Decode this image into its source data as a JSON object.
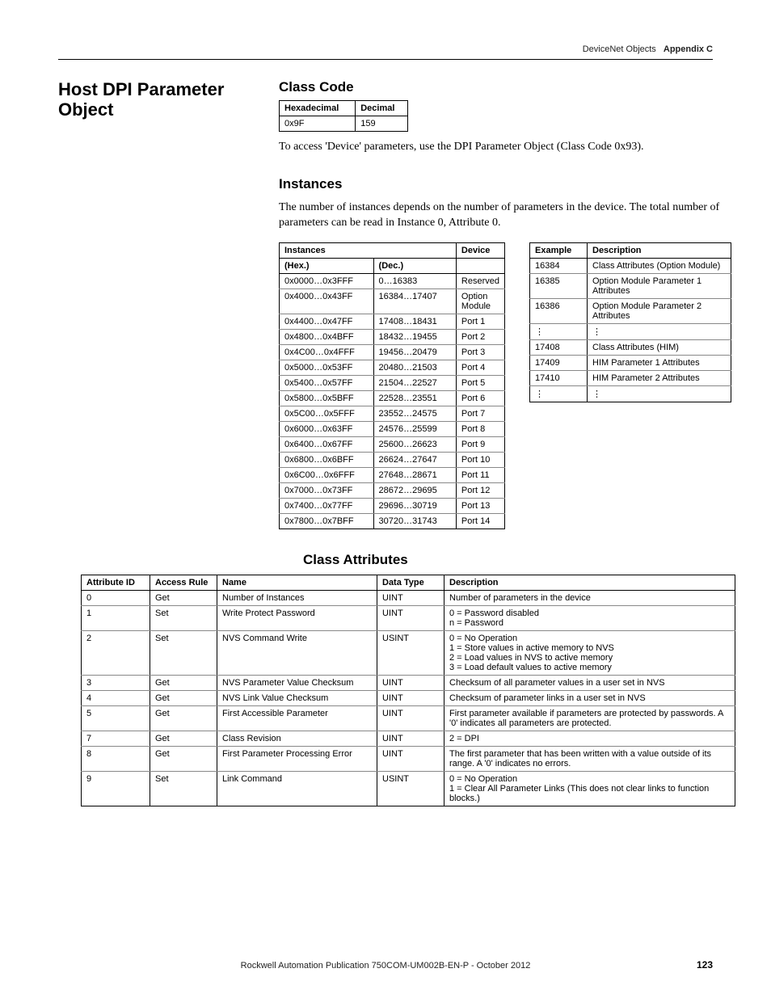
{
  "header": {
    "chapter_title": "DeviceNet Objects",
    "appendix": "Appendix C"
  },
  "section": {
    "title": "Host DPI Parameter Object"
  },
  "class_code": {
    "heading": "Class Code",
    "col_hex": "Hexadecimal",
    "col_dec": "Decimal",
    "row_hex": "0x9F",
    "row_dec": "159",
    "paragraph": "To access 'Device' parameters, use the DPI Parameter Object (Class Code 0x93)."
  },
  "instances": {
    "heading": "Instances",
    "paragraph": "The number of instances depends on the number of parameters in the device. The total number of parameters can be read in Instance 0, Attribute 0.",
    "t1": {
      "h_inst": "Instances",
      "h_dev": "Device",
      "h_hex": "(Hex.)",
      "h_dec": "(Dec.)",
      "rows": [
        {
          "hex": "0x0000…0x3FFF",
          "dec": "0…16383",
          "dev": "Reserved"
        },
        {
          "hex": "0x4000…0x43FF",
          "dec": "16384…17407",
          "dev": "Option Module"
        },
        {
          "hex": "0x4400…0x47FF",
          "dec": "17408…18431",
          "dev": "Port 1"
        },
        {
          "hex": "0x4800…0x4BFF",
          "dec": "18432…19455",
          "dev": "Port 2"
        },
        {
          "hex": "0x4C00…0x4FFF",
          "dec": "19456…20479",
          "dev": "Port 3"
        },
        {
          "hex": "0x5000…0x53FF",
          "dec": "20480…21503",
          "dev": "Port 4"
        },
        {
          "hex": "0x5400…0x57FF",
          "dec": "21504…22527",
          "dev": "Port 5"
        },
        {
          "hex": "0x5800…0x5BFF",
          "dec": "22528…23551",
          "dev": "Port 6"
        },
        {
          "hex": "0x5C00…0x5FFF",
          "dec": "23552…24575",
          "dev": "Port 7"
        },
        {
          "hex": "0x6000…0x63FF",
          "dec": "24576…25599",
          "dev": "Port 8"
        },
        {
          "hex": "0x6400…0x67FF",
          "dec": "25600…26623",
          "dev": "Port 9"
        },
        {
          "hex": "0x6800…0x6BFF",
          "dec": "26624…27647",
          "dev": "Port 10"
        },
        {
          "hex": "0x6C00…0x6FFF",
          "dec": "27648…28671",
          "dev": "Port 11"
        },
        {
          "hex": "0x7000…0x73FF",
          "dec": "28672…29695",
          "dev": "Port 12"
        },
        {
          "hex": "0x7400…0x77FF",
          "dec": "29696…30719",
          "dev": "Port 13"
        },
        {
          "hex": "0x7800…0x7BFF",
          "dec": "30720…31743",
          "dev": "Port 14"
        }
      ]
    },
    "t2": {
      "h_ex": "Example",
      "h_desc": "Description",
      "rows": [
        {
          "ex": "16384",
          "desc": "Class Attributes (Option Module)"
        },
        {
          "ex": "16385",
          "desc": "Option Module Parameter 1 Attributes"
        },
        {
          "ex": "16386",
          "desc": "Option Module Parameter 2 Attributes"
        },
        {
          "ex": "⋮",
          "desc": "⋮"
        },
        {
          "ex": "17408",
          "desc": "Class Attributes (HIM)"
        },
        {
          "ex": "17409",
          "desc": "HIM Parameter 1 Attributes"
        },
        {
          "ex": "17410",
          "desc": "HIM Parameter 2 Attributes"
        },
        {
          "ex": "⋮",
          "desc": "⋮"
        }
      ]
    }
  },
  "class_attrs": {
    "heading": "Class Attributes",
    "cols": {
      "id": "Attribute ID",
      "rule": "Access Rule",
      "name": "Name",
      "type": "Data Type",
      "desc": "Description"
    },
    "rows": [
      {
        "id": "0",
        "rule": "Get",
        "name": "Number of Instances",
        "type": "UINT",
        "desc": "Number of parameters in the device"
      },
      {
        "id": "1",
        "rule": "Set",
        "name": "Write Protect Password",
        "type": "UINT",
        "desc": "0 = Password disabled\nn = Password"
      },
      {
        "id": "2",
        "rule": "Set",
        "name": "NVS Command Write",
        "type": "USINT",
        "desc": "0 = No Operation\n1 = Store values in active memory to NVS\n2 = Load values in NVS to active memory\n3 = Load default values to active memory"
      },
      {
        "id": "3",
        "rule": "Get",
        "name": "NVS Parameter Value Checksum",
        "type": "UINT",
        "desc": "Checksum of all parameter values in a user set in NVS"
      },
      {
        "id": "4",
        "rule": "Get",
        "name": "NVS Link Value Checksum",
        "type": "UINT",
        "desc": "Checksum of parameter links in a user set in NVS"
      },
      {
        "id": "5",
        "rule": "Get",
        "name": "First Accessible Parameter",
        "type": "UINT",
        "desc": "First parameter available if parameters are protected by passwords. A '0' indicates all parameters are protected."
      },
      {
        "id": "7",
        "rule": "Get",
        "name": "Class Revision",
        "type": "UINT",
        "desc": "2 = DPI"
      },
      {
        "id": "8",
        "rule": "Get",
        "name": "First Parameter Processing Error",
        "type": "UINT",
        "desc": "The first parameter that has been written with a value outside of its range. A '0' indicates no errors."
      },
      {
        "id": "9",
        "rule": "Set",
        "name": "Link Command",
        "type": "USINT",
        "desc": "0 = No Operation\n1 = Clear All Parameter Links (This does not clear links to function blocks.)"
      }
    ]
  },
  "footer": {
    "text": "Rockwell Automation Publication 750COM-UM002B-EN-P - October 2012",
    "page": "123"
  }
}
